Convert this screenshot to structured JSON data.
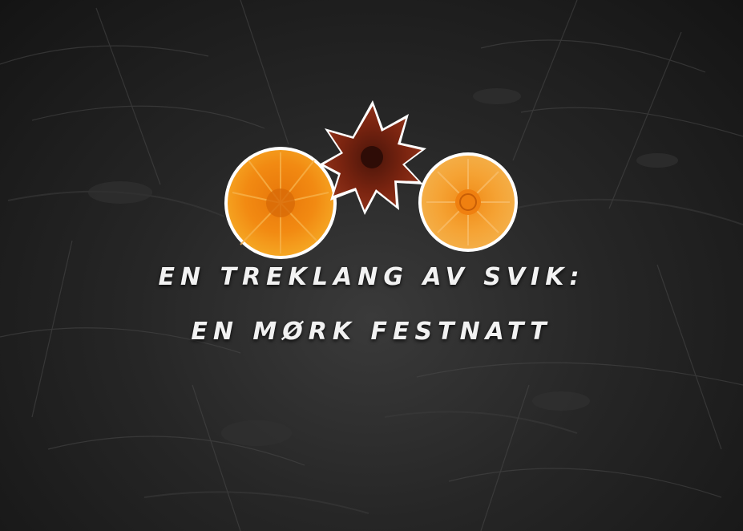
{
  "poster": {
    "title_line_1": "EN TREKLANG AV SVIK:",
    "title_line_2": "EN MØRK FESTNATT"
  },
  "colors": {
    "background": "#262626",
    "title_text": "#f2f2f2",
    "flower_orange": "#f28a12",
    "flower_orange_light": "#f5a623",
    "flower_dark_red": "#7a2410",
    "sticker_outline": "#ffffff"
  },
  "illustration": {
    "background": "dark-grass-photo",
    "flowers": [
      "orange-dandelion",
      "dark-red-dandelion",
      "orange-dandelion"
    ]
  }
}
